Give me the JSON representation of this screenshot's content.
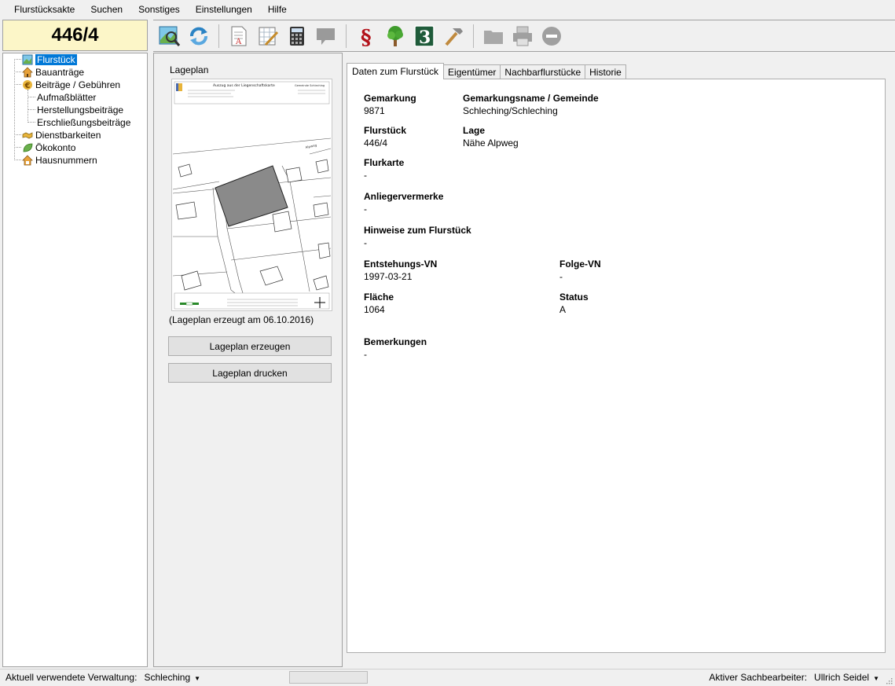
{
  "menu": [
    "Flurstücksakte",
    "Suchen",
    "Sonstiges",
    "Einstellungen",
    "Hilfe"
  ],
  "parcel_number": "446/4",
  "toolbar_icons": [
    "map-search-icon",
    "refresh-icon",
    "document-icon",
    "edit-sheet-icon",
    "calculator-icon",
    "comment-icon",
    "paragraph-icon",
    "tree-icon",
    "number-3-icon",
    "hammer-icon",
    "folder-icon",
    "printer-icon",
    "stop-icon"
  ],
  "tree": {
    "items": [
      {
        "label": "Flurstück",
        "icon": "parcel-icon"
      },
      {
        "label": "Bauanträge",
        "icon": "house-icon"
      },
      {
        "label": "Beiträge / Gebühren",
        "icon": "euro-icon"
      },
      {
        "label": "Aufmaßblätter"
      },
      {
        "label": "Herstellungsbeiträge"
      },
      {
        "label": "Erschließungsbeiträge"
      },
      {
        "label": "Dienstbarkeiten",
        "icon": "handshake-icon"
      },
      {
        "label": "Ökokonto",
        "icon": "leaf-icon"
      },
      {
        "label": "Hausnummern",
        "icon": "house-number-icon"
      }
    ]
  },
  "lageplan": {
    "group_label": "Lageplan",
    "caption": "(Lageplan erzeugt am 06.10.2016)",
    "create_button": "Lageplan erzeugen",
    "print_button": "Lageplan drucken",
    "map_title": "Auszug aus der Liegenschaftskarte",
    "map_org": "Gemeinde Schleching",
    "map_road": "Alpweg"
  },
  "tabs": [
    "Daten zum Flurstück",
    "Eigentümer",
    "Nachbarflurstücke",
    "Historie"
  ],
  "fields": {
    "gemarkung_label": "Gemarkung",
    "gemarkung": "9871",
    "gemarkungsname_label": "Gemarkungsname / Gemeinde",
    "gemarkungsname": "Schleching/Schleching",
    "flurstueck_label": "Flurstück",
    "flurstueck": "446/4",
    "lage_label": "Lage",
    "lage": "Nähe Alpweg",
    "flurkarte_label": "Flurkarte",
    "flurkarte": "-",
    "anlieger_label": "Anliegervermerke",
    "anlieger": "-",
    "hinweise_label": "Hinweise zum Flurstück",
    "hinweise": "-",
    "entstehung_label": "Entstehungs-VN",
    "entstehung": "1997-03-21",
    "folge_label": "Folge-VN",
    "folge": "-",
    "flaeche_label": "Fläche",
    "flaeche": "1064",
    "status_label": "Status",
    "status": "A",
    "bemerkungen_label": "Bemerkungen",
    "bemerkungen": "-"
  },
  "statusbar": {
    "verwaltung_label": "Aktuell verwendete Verwaltung:",
    "verwaltung": "Schleching",
    "sachbearbeiter_label": "Aktiver Sachbearbeiter:",
    "sachbearbeiter": "Ullrich Seidel"
  }
}
